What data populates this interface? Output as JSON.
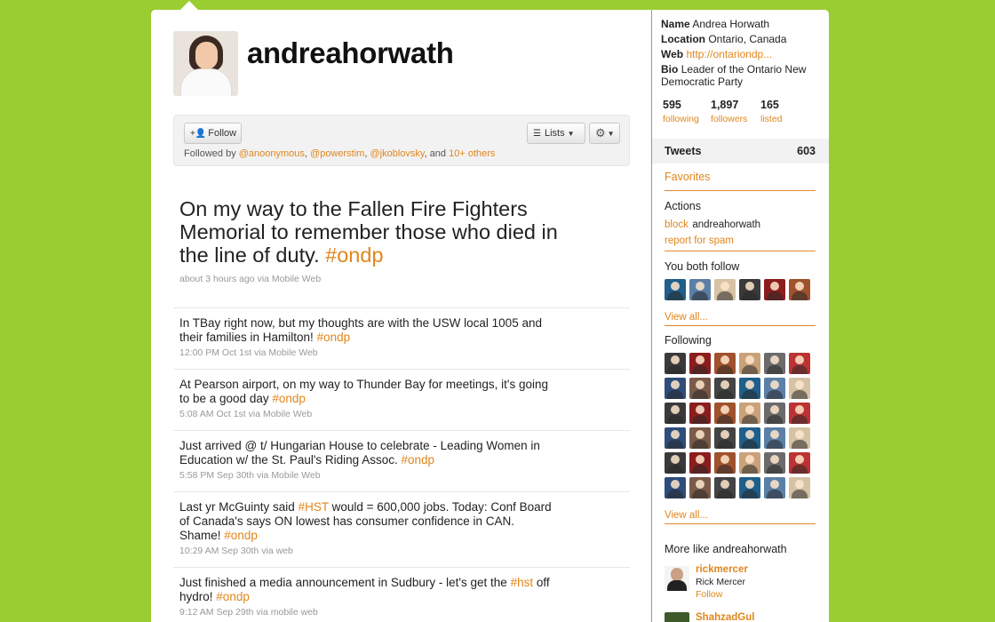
{
  "profile": {
    "screen_name": "andreahorwath",
    "follow_label": "Follow",
    "lists_label": "Lists",
    "followed_by": {
      "prefix": "Followed by",
      "users": [
        "@anoonymous",
        "@powerstim",
        "@jkoblovsky"
      ],
      "and": "and",
      "others": "10+ others"
    }
  },
  "featured_tweet": {
    "text": "On my way to the Fallen Fire Fighters Memorial to remember those who died in the line of duty.",
    "hashtag": "#ondp",
    "meta": "about 3 hours ago via Mobile Web"
  },
  "tweets": [
    {
      "text": "In TBay right now, but my thoughts are with the USW local 1005 and their families in Hamilton!",
      "hashtag": "#ondp",
      "meta": "12:00 PM Oct 1st via Mobile Web"
    },
    {
      "text": "At Pearson airport, on my way to Thunder Bay for meetings, it's going to be a good day",
      "hashtag": "#ondp",
      "meta": "5:08 AM Oct 1st via Mobile Web"
    },
    {
      "text": "Just arrived @ t/ Hungarian House to celebrate - Leading Women in Education w/ the St. Paul's Riding Assoc.",
      "hashtag": "#ondp",
      "meta": "5:58 PM Sep 30th via Mobile Web"
    },
    {
      "text_a": "Last yr McGuinty said",
      "tag_a": "#HST",
      "text_b": "would = 600,000 jobs. Today: Conf Board of Canada's says ON lowest has consumer confidence in CAN. Shame!",
      "hashtag": "#ondp",
      "meta": "10:29 AM Sep 30th via web"
    },
    {
      "text_a": "Just finished a media announcement in Sudbury - let's get the",
      "tag_a": "#hst",
      "text_b": "off hydro!",
      "hashtag": "#ondp",
      "meta": "9:12 AM Sep 29th via mobile web"
    }
  ],
  "sidebar": {
    "bio": {
      "name_label": "Name",
      "name": "Andrea Horwath",
      "location_label": "Location",
      "location": "Ontario, Canada",
      "web_label": "Web",
      "web": "http://ontariondp...",
      "bio_label": "Bio",
      "bio": "Leader of the Ontario New Democratic Party"
    },
    "stats": [
      {
        "value": "595",
        "label": "following"
      },
      {
        "value": "1,897",
        "label": "followers"
      },
      {
        "value": "165",
        "label": "listed"
      }
    ],
    "tweets_label": "Tweets",
    "tweets_count": "603",
    "favorites_label": "Favorites",
    "actions_title": "Actions",
    "block_label": "block",
    "block_target": "andreahorwath",
    "report_label": "report for spam",
    "you_both_follow_title": "You both follow",
    "view_all_label": "View all...",
    "following_title": "Following",
    "more_like_title": "More like andreahorwath",
    "more_like": [
      {
        "handle": "rickmercer",
        "name": "Rick Mercer",
        "follow": "Follow"
      },
      {
        "handle": "ShahzadGul"
      }
    ]
  },
  "colors": {
    "background": "#9ACD32",
    "link": "#e0861c",
    "separator": "#e08a2a"
  }
}
